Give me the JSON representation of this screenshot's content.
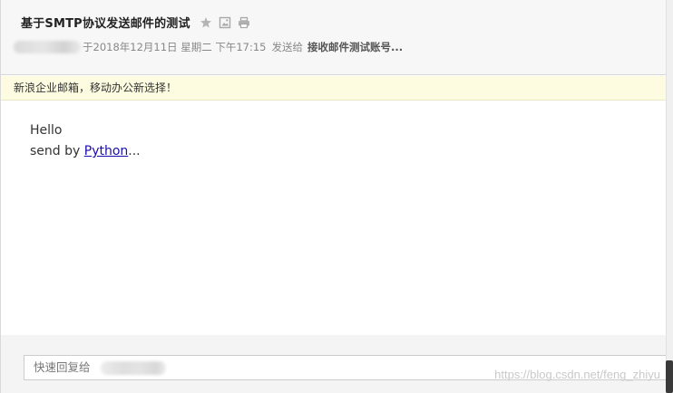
{
  "email": {
    "subject": "基于SMTP协议发送邮件的测试",
    "icons": [
      "star-icon",
      "image-icon",
      "print-icon"
    ],
    "meta": {
      "date_text": "于2018年12月11日 星期二 下午17:15",
      "sent_to_label": "发送给",
      "recipient": "接收邮件测试账号..."
    }
  },
  "notice": {
    "text": "新浪企业邮箱，移动办公新选择！"
  },
  "body": {
    "line1": "Hello",
    "line2_prefix": "send by ",
    "link_text": "Python",
    "line2_suffix": "..."
  },
  "reply": {
    "placeholder": "快速回复给"
  },
  "watermark": "https://blog.csdn.net/feng_zhiyu",
  "colors": {
    "link": "#1a0dab",
    "notice_bg": "#fdfbe0",
    "header_bg": "#f7f7f7"
  }
}
